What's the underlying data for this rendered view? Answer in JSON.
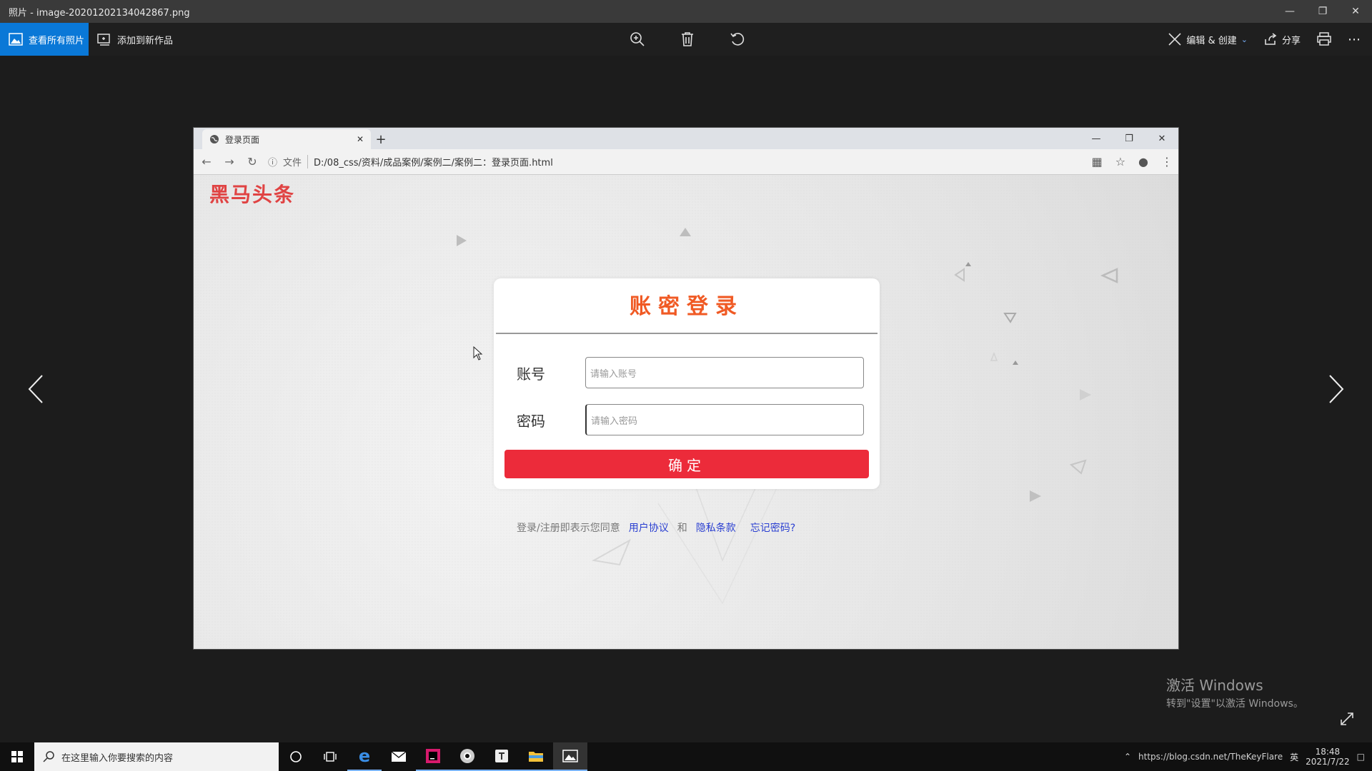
{
  "photos_app": {
    "title": "照片 - image-20201202134042867.png",
    "view_all_label": "查看所有照片",
    "add_label": "添加到新作品",
    "edit_create_label": "编辑 & 创建",
    "share_label": "分享"
  },
  "browser": {
    "tab_title": "登录页面",
    "scheme_label": "文件",
    "url": "D:/08_css/资料/成品案例/案例二/案例二：登录页面.html"
  },
  "page": {
    "brand": "黑马头条",
    "login_title": "账密登录",
    "account_label": "账号",
    "account_placeholder": "请输入账号",
    "password_label": "密码",
    "password_placeholder": "请输入密码",
    "submit_label": "确定",
    "agreement_prefix": "登录/注册即表示您同意",
    "user_agreement": "用户协议",
    "and": "和",
    "privacy": "隐私条款",
    "forgot": "忘记密码?"
  },
  "watermark": {
    "title": "激活 Windows",
    "subtitle": "转到\"设置\"以激活 Windows。"
  },
  "taskbar": {
    "search_placeholder": "在这里输入你要搜索的内容",
    "tray_text": "https://blog.csdn.net/TheKeyFlare",
    "lang": "英",
    "time": "18:48",
    "date": "2021/7/22"
  },
  "colors": {
    "accent_blue": "#0a78d7",
    "brand_red": "#e04343",
    "title_orange": "#f05a24",
    "button_red": "#ec2b3a",
    "link_blue": "#2a3fd1"
  }
}
